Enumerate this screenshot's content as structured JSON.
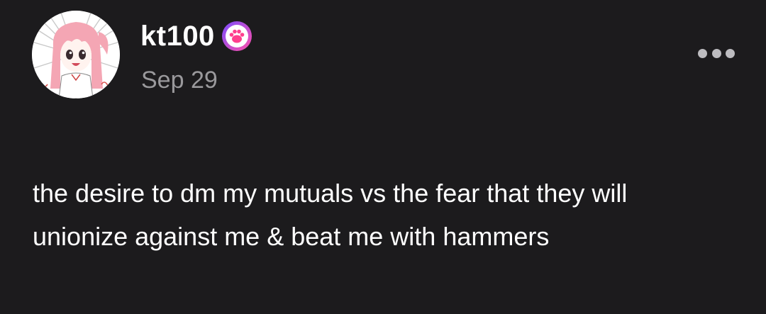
{
  "post": {
    "author": {
      "username": "kt100",
      "avatar_icon": "anime-girl-avatar",
      "badge_icon": "paw-badge-icon"
    },
    "date": "Sep 29",
    "body": "the desire to dm my mutuals vs the fear that they will unionize against me & beat me with hammers",
    "more_icon": "ellipsis-icon"
  },
  "colors": {
    "background": "#1c1b1d",
    "text": "#ffffff",
    "date_text": "#9a999c",
    "badge_gradient_start": "#7b4dff",
    "badge_gradient_end": "#ff4fa8"
  }
}
